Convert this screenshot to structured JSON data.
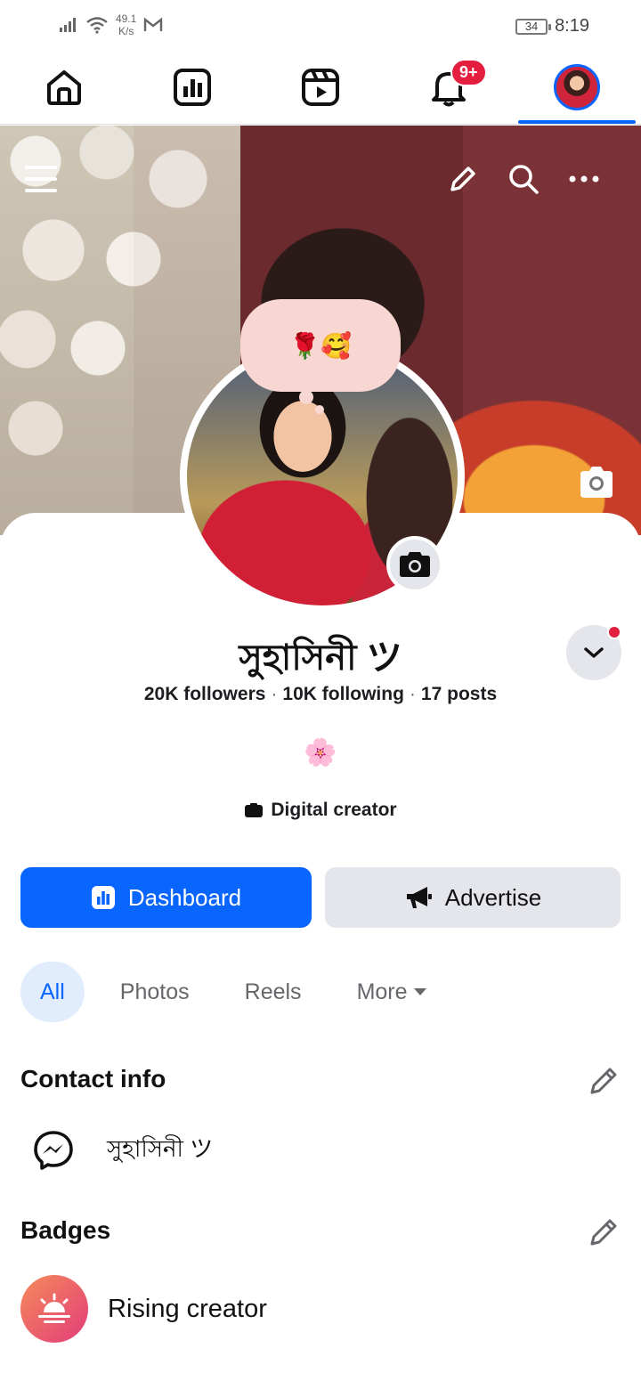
{
  "status_bar": {
    "net_speed_value": "49.1",
    "net_speed_unit": "K/s",
    "battery": "34",
    "time": "8:19"
  },
  "nav": {
    "icons": [
      "home-icon",
      "dashboard-icon",
      "reels-icon",
      "bell-icon",
      "profile-avatar"
    ],
    "notifications_badge": "9+"
  },
  "cover": {
    "actions": [
      "menu-icon",
      "pencil-icon",
      "search-icon",
      "more-icon",
      "camera-icon"
    ]
  },
  "note": {
    "text": "🌹🥰"
  },
  "profile": {
    "name": "সুহাসিনী ツ",
    "followers": "20K followers",
    "following": "10K following",
    "posts": "17 posts",
    "separator": "·",
    "bio_emoji": "🌸",
    "category": "Digital creator"
  },
  "buttons": {
    "dashboard": "Dashboard",
    "advertise": "Advertise"
  },
  "tabs": [
    "All",
    "Photos",
    "Reels",
    "More"
  ],
  "contact_info": {
    "title": "Contact info",
    "messenger_name": "সুহাসিনী ツ"
  },
  "badges": {
    "title": "Badges",
    "item": "Rising creator"
  },
  "colors": {
    "accent": "#0866ff",
    "notification": "#e41e3f",
    "note_bubble": "#f8d7d3"
  }
}
